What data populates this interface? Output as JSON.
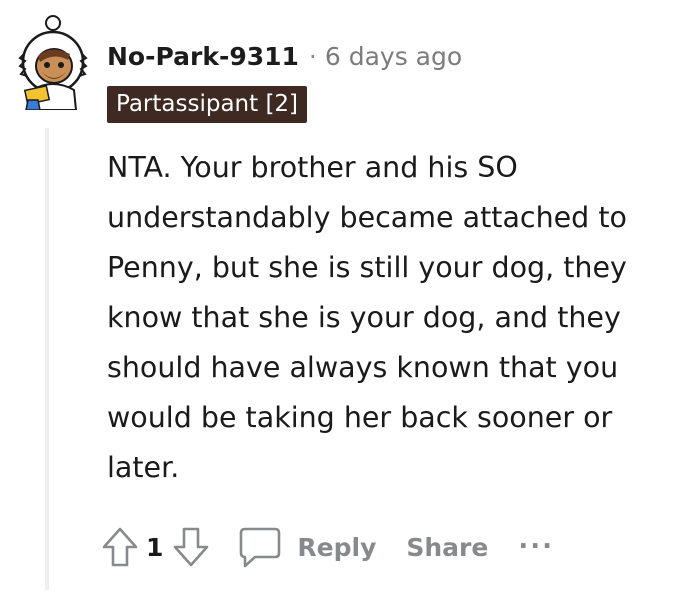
{
  "comment": {
    "username": "No-Park-9311",
    "separator": "·",
    "timestamp": "6 days ago",
    "flair": "Partassipant [2]",
    "body": "NTA. Your brother and his SO understandably became attached to Penny, but she is still your dog, they know that she is your dog, and they should have always known that you would be taking her back sooner or later."
  },
  "actions": {
    "upvote_icon": "upvote-arrow-icon",
    "vote_count": "1",
    "downvote_icon": "downvote-arrow-icon",
    "reply_icon": "speech-bubble-icon",
    "reply_label": "Reply",
    "share_label": "Share",
    "more_label": "..."
  },
  "colors": {
    "flair_background": "#3f2a23",
    "action_gray": "#878a8c",
    "thread_line": "#edeff1"
  }
}
